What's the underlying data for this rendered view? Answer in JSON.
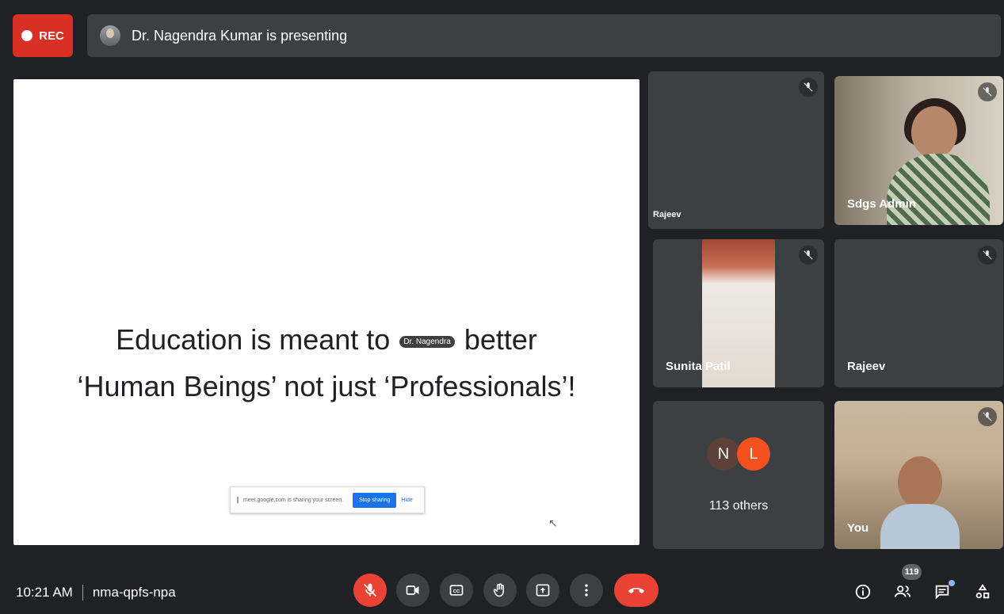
{
  "topbar": {
    "rec_label": "REC",
    "presenting_text": "Dr. Nagendra Kumar is presenting"
  },
  "slide": {
    "line1_before": "Education is meant to ",
    "line1_chip": "Dr. Nagendra",
    "line1_after": " better",
    "line2": "‘Human Beings’ not just ‘Professionals’!"
  },
  "share_bar": {
    "message": "meet.google.com is sharing your screen.",
    "stop_label": "Stop sharing",
    "hide_label": "Hide"
  },
  "participants": [
    {
      "name": "Rajeev"
    },
    {
      "name": "Sdgs Admin"
    },
    {
      "name": "Sunita Patil"
    },
    {
      "name": "Rajeev"
    },
    {
      "name": "You"
    }
  ],
  "others": {
    "avatars": [
      "N",
      "L"
    ],
    "count_label": "113 others"
  },
  "bottom": {
    "time": "10:21 AM",
    "meeting_code": "nma-qpfs-npa",
    "people_count": "119"
  },
  "colors": {
    "background": "#202124",
    "tile": "#3c4043",
    "rec": "#d93025",
    "end_call": "#ea4335",
    "accent": "#1a73e8"
  }
}
